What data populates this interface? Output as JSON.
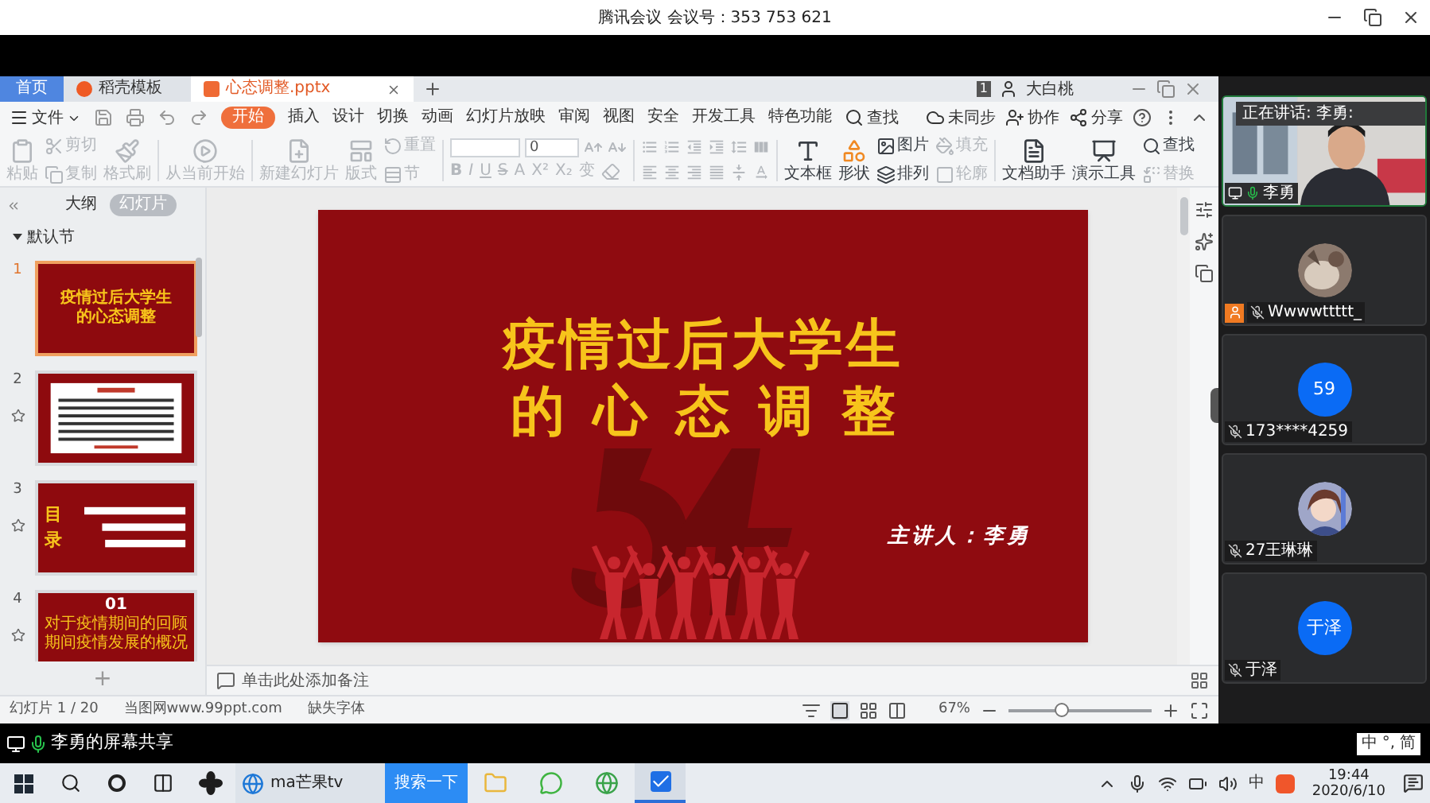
{
  "meeting": {
    "title": "腾讯会议 会议号：353 753 621"
  },
  "doc_tabs": [
    {
      "label": "首页",
      "kind": "home",
      "selected": false
    },
    {
      "label": "稻壳模板",
      "kind": "template",
      "selected": false
    },
    {
      "label": "心态调整.pptx",
      "kind": "file",
      "selected": true
    }
  ],
  "account": {
    "badge": "1",
    "name": "大白桃"
  },
  "file_menu": "文件",
  "ribbon_tabs": [
    {
      "label": "开始",
      "selected": true
    },
    {
      "label": "插入",
      "selected": false
    },
    {
      "label": "设计",
      "selected": false
    },
    {
      "label": "切换",
      "selected": false
    },
    {
      "label": "动画",
      "selected": false
    },
    {
      "label": "幻灯片放映",
      "selected": false
    },
    {
      "label": "审阅",
      "selected": false
    },
    {
      "label": "视图",
      "selected": false
    },
    {
      "label": "安全",
      "selected": false
    },
    {
      "label": "开发工具",
      "selected": false
    },
    {
      "label": "特色功能",
      "selected": false
    }
  ],
  "search_label": "查找",
  "cloud_actions": [
    "未同步",
    "协作",
    "分享"
  ],
  "ribbon": [
    {
      "kind": "large",
      "items": [
        {
          "label": "粘贴",
          "disabled": true
        }
      ]
    },
    {
      "kind": "stack",
      "items": [
        {
          "label": "剪切",
          "disabled": true
        },
        {
          "label": "复制",
          "disabled": true
        }
      ]
    },
    {
      "kind": "large",
      "items": [
        {
          "label": "格式刷",
          "disabled": true
        }
      ]
    },
    {
      "kind": "divider"
    },
    {
      "kind": "large",
      "items": [
        {
          "label": "从当前开始",
          "disabled": true
        }
      ]
    },
    {
      "kind": "divider"
    },
    {
      "kind": "large",
      "items": [
        {
          "label": "新建幻灯片",
          "disabled": true
        }
      ]
    },
    {
      "kind": "large",
      "items": [
        {
          "label": "版式",
          "disabled": true
        }
      ]
    },
    {
      "kind": "stack",
      "items": [
        {
          "label": "重置",
          "disabled": true
        },
        {
          "label": "节",
          "disabled": true
        }
      ]
    },
    {
      "kind": "divider"
    },
    {
      "kind": "font",
      "size": "0",
      "format": [
        "B",
        "I",
        "U",
        "S",
        "A",
        "X²",
        "X₂",
        "变"
      ]
    },
    {
      "kind": "divider"
    },
    {
      "kind": "paragraph"
    },
    {
      "kind": "divider"
    },
    {
      "kind": "large",
      "items": [
        {
          "label": "文本框",
          "disabled": false
        }
      ]
    },
    {
      "kind": "large",
      "items": [
        {
          "label": "形状",
          "disabled": false
        }
      ]
    },
    {
      "kind": "stack",
      "items": [
        {
          "label": "图片",
          "disabled": false
        },
        {
          "label": "排列",
          "disabled": false
        }
      ]
    },
    {
      "kind": "stack",
      "items": [
        {
          "label": "填充",
          "disabled": true
        },
        {
          "label": "轮廓",
          "disabled": true
        }
      ]
    },
    {
      "kind": "divider"
    },
    {
      "kind": "large",
      "items": [
        {
          "label": "文档助手",
          "disabled": false
        }
      ]
    },
    {
      "kind": "large",
      "items": [
        {
          "label": "演示工具",
          "disabled": false
        }
      ]
    },
    {
      "kind": "stack",
      "items": [
        {
          "label": "查找",
          "disabled": false
        },
        {
          "label": "替换",
          "disabled": true
        }
      ]
    }
  ],
  "panel_tabs": [
    {
      "label": "大纲",
      "selected": false
    },
    {
      "label": "幻灯片",
      "selected": true
    }
  ],
  "section": "默认节",
  "slides": [
    {
      "number": "1",
      "kind": "title",
      "selected": true,
      "animated": false,
      "lines": [
        "疫情过后大学生",
        "的心态调整"
      ]
    },
    {
      "number": "2",
      "kind": "text",
      "selected": false,
      "animated": true
    },
    {
      "number": "3",
      "kind": "contents",
      "selected": false,
      "animated": true,
      "lines": [
        "目录"
      ]
    },
    {
      "number": "4",
      "kind": "chapter",
      "selected": false,
      "animated": true,
      "lines": [
        "01",
        "对于疫情期间的回顾",
        "期间疫情发展的概况"
      ]
    }
  ],
  "add_slide": "+",
  "slide": {
    "title_lines": [
      "疫情过后大学生",
      "的心态调整"
    ],
    "speaker": "主讲人：李勇"
  },
  "notes_placeholder": "单击此处添加备注",
  "status": {
    "items": [
      "幻灯片 1 / 20",
      "当图网www.99ppt.com",
      "缺失字体"
    ],
    "zoom": "67%",
    "level": 0.37
  },
  "speaking": "正在讲话: 李勇:",
  "participants": [
    {
      "name": "李勇",
      "kind": "video",
      "muted": false,
      "sharing": true,
      "host": false
    },
    {
      "name": "Wwwwttttt_",
      "muted": true,
      "sharing": false,
      "host": true
    },
    {
      "name": "173****4259",
      "kind": "initials",
      "initials": "59",
      "muted": true,
      "sharing": false,
      "host": false
    },
    {
      "name": "27王琳琳",
      "muted": true,
      "sharing": false,
      "host": false
    },
    {
      "name": "于泽",
      "kind": "initials",
      "initials": "于泽",
      "muted": true,
      "sharing": false,
      "host": false
    }
  ],
  "share_label": "李勇的屏幕共享",
  "ime": [
    "中",
    "°,",
    "简"
  ],
  "taskbar": {
    "browser": "ma芒果tv",
    "search_button": "搜索一下",
    "tray_lang": "中",
    "time": "19:44",
    "date": "2020/6/10"
  }
}
